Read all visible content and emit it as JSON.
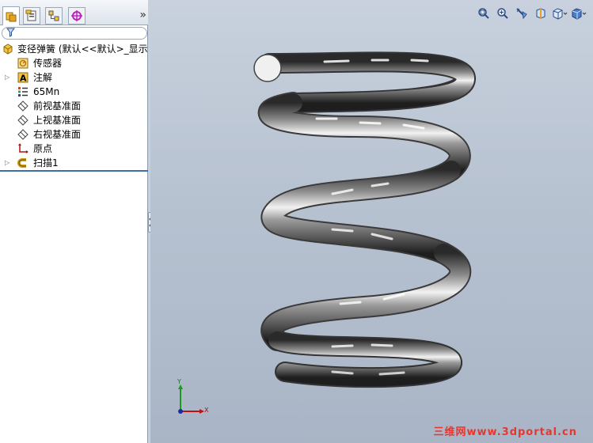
{
  "panel": {
    "tabs": [
      {
        "name": "featuremanager",
        "icon": "feature-tree-icon"
      },
      {
        "name": "propertymanager",
        "icon": "property-manager-icon"
      },
      {
        "name": "configurationmanager",
        "icon": "configuration-manager-icon"
      },
      {
        "name": "dimxpertmanager",
        "icon": "dimxpert-icon"
      }
    ],
    "collapse_label": "»",
    "filter_icon": "filter-icon",
    "tree": [
      {
        "label": "变径弹簧  (默认<<默认>_显示状态",
        "icon": "part-icon",
        "expandable": false
      },
      {
        "label": "传感器",
        "icon": "sensor-icon",
        "expandable": false
      },
      {
        "label": "注解",
        "icon": "annotation-icon",
        "expandable": true
      },
      {
        "label": "65Mn",
        "icon": "material-icon",
        "expandable": false
      },
      {
        "label": "前视基准面",
        "icon": "plane-icon",
        "expandable": false
      },
      {
        "label": "上视基准面",
        "icon": "plane-icon",
        "expandable": false
      },
      {
        "label": "右视基准面",
        "icon": "plane-icon",
        "expandable": false
      },
      {
        "label": "原点",
        "icon": "origin-icon",
        "expandable": false
      },
      {
        "label": "扫描1",
        "icon": "sweep-icon",
        "expandable": true
      }
    ]
  },
  "viewport": {
    "toolbar": [
      {
        "name": "zoom-to-fit",
        "icon": "zoom-fit-icon"
      },
      {
        "name": "zoom-to-area",
        "icon": "zoom-area-icon"
      },
      {
        "name": "previous-view",
        "icon": "previous-view-icon"
      },
      {
        "name": "section-view",
        "icon": "section-view-icon"
      },
      {
        "name": "view-orientation",
        "icon": "view-orientation-icon"
      },
      {
        "name": "display-style",
        "icon": "display-style-icon"
      }
    ],
    "axes": {
      "x": "X",
      "y": "Y"
    },
    "watermark": "三维网www.3dportal.cn"
  },
  "colors": {
    "viewport_top": "#c8d1dd",
    "viewport_bottom": "#a9b5c6",
    "panel_accent": "#3c6ea8",
    "watermark": "#e8362f"
  }
}
